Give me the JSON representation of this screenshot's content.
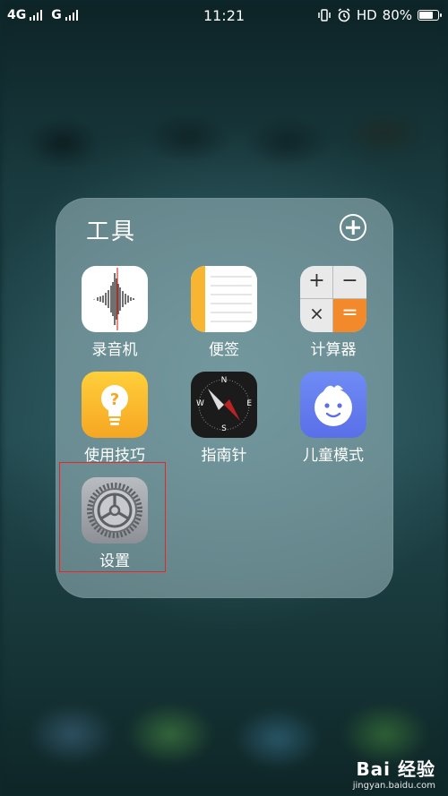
{
  "status_bar": {
    "network1": "4G",
    "network2": "G",
    "time": "11:21",
    "hd_label": "HD",
    "battery_text": "80%",
    "battery_level": 0.8
  },
  "folder": {
    "title": "工具",
    "apps": [
      {
        "label": "录音机",
        "icon": "waveform-icon"
      },
      {
        "label": "便签",
        "icon": "notes-icon"
      },
      {
        "label": "计算器",
        "icon": "calculator-icon"
      },
      {
        "label": "使用技巧",
        "icon": "lightbulb-icon"
      },
      {
        "label": "指南针",
        "icon": "compass-icon"
      },
      {
        "label": "儿童模式",
        "icon": "baby-face-icon"
      },
      {
        "label": "设置",
        "icon": "gear-icon"
      }
    ]
  },
  "calculator": {
    "plus": "+",
    "minus": "−",
    "times": "×",
    "equals": "="
  },
  "compass": {
    "n": "N",
    "s": "S",
    "e": "E",
    "w": "W"
  },
  "watermark": {
    "brand": "Bai 经验",
    "url": "jingyan.baidu.com"
  },
  "colors": {
    "highlight": "#e6262b",
    "accent_orange": "#f28a2c",
    "notes_yellow": "#f7b531"
  }
}
